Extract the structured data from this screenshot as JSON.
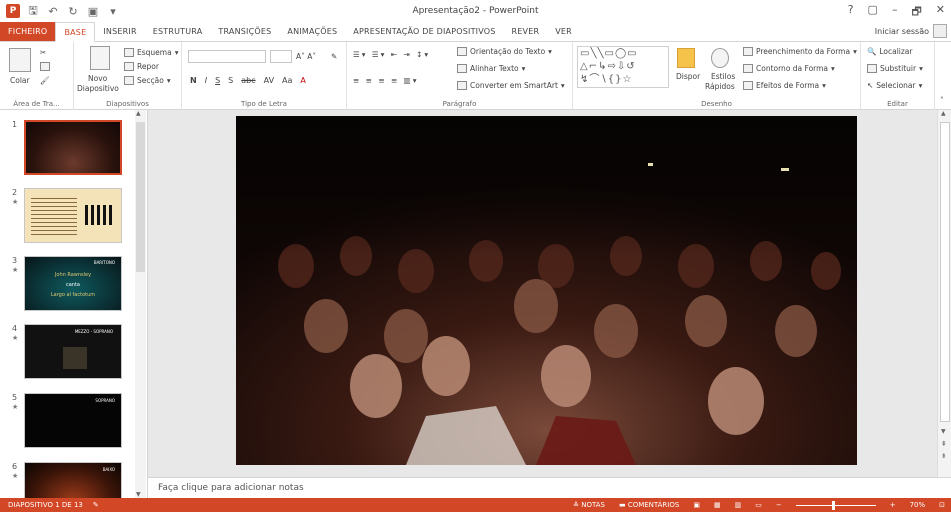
{
  "titlebar": {
    "title": "Apresentação2 - PowerPoint",
    "qat": [
      "save-icon",
      "undo-icon",
      "redo-icon",
      "start-slideshow-icon",
      "customize-icon"
    ],
    "help": "?",
    "minimize": "–",
    "restore": "🗗",
    "close": "✕"
  },
  "tabs": [
    "FICHEIRO",
    "BASE",
    "INSERIR",
    "ESTRUTURA",
    "TRANSIÇÕES",
    "ANIMAÇÕES",
    "APRESENTAÇÃO DE DIAPOSITIVOS",
    "REVER",
    "VER"
  ],
  "active_tab": "BASE",
  "signin": "Iniciar sessão",
  "ribbon": {
    "clipboard": {
      "label": "Área de Tra...",
      "paste": "Colar"
    },
    "slides": {
      "label": "Diapositivos",
      "new_slide_1": "Novo",
      "new_slide_2": "Diapositivo",
      "layout": "Esquema",
      "reset": "Repor",
      "section": "Secção"
    },
    "font": {
      "label": "Tipo de Letra",
      "bold": "N",
      "italic": "I",
      "underline": "S",
      "shadow": "S",
      "strike": "abc",
      "spacing": "AV",
      "case": "Aa",
      "color": "A"
    },
    "paragraph": {
      "label": "Parágrafo",
      "text_direction": "Orientação do Texto",
      "align_text": "Alinhar Texto",
      "smartart": "Converter em SmartArt"
    },
    "drawing": {
      "label": "Desenho",
      "arrange": "Dispor",
      "quick_styles_1": "Estilos",
      "quick_styles_2": "Rápidos",
      "fill": "Preenchimento da Forma",
      "outline": "Contorno da Forma",
      "effects": "Efeitos de Forma"
    },
    "editing": {
      "label": "Editar",
      "find": "Localizar",
      "replace": "Substituir",
      "select": "Selecionar"
    }
  },
  "slides": [
    {
      "num": "1",
      "star": ""
    },
    {
      "num": "2",
      "star": "★"
    },
    {
      "num": "3",
      "star": "★"
    },
    {
      "num": "4",
      "star": "★"
    },
    {
      "num": "5",
      "star": "★"
    },
    {
      "num": "6",
      "star": "★"
    }
  ],
  "slide_texts": {
    "s3_title": "BARITONO",
    "s3_name": "John Rawnsley",
    "s3_canta": "canta",
    "s3_song": "Largo al factotum",
    "s4_title": "MEZZO - SOPRANO",
    "s5_title": "SOPRANO",
    "s6_title": "BAIXO"
  },
  "notes_placeholder": "Faça clique para adicionar notas",
  "status": {
    "slide_info": "DIAPOSITIVO 1 DE 13",
    "notes": "NOTAS",
    "comments": "COMENTÁRIOS",
    "zoom": "70%"
  },
  "colors": {
    "accent": "#d24726"
  }
}
